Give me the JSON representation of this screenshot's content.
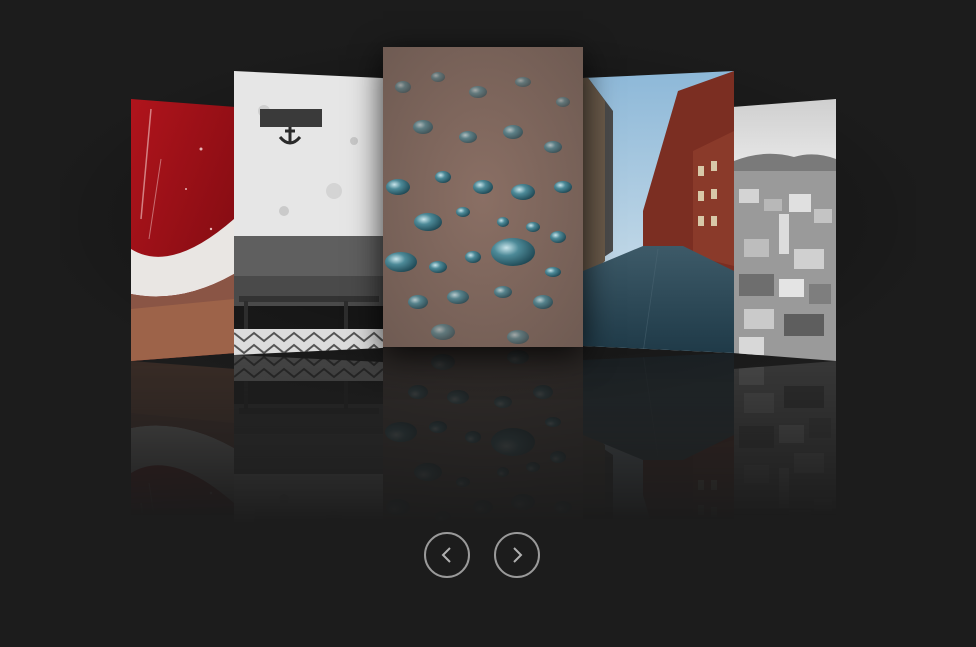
{
  "carousel": {
    "slides": [
      {
        "icon": "red-door-photo",
        "position": "far-left"
      },
      {
        "icon": "white-wall-anchor-bench-photo",
        "position": "left"
      },
      {
        "icon": "water-droplets-photo",
        "position": "center",
        "active": true
      },
      {
        "icon": "city-street-photo",
        "position": "right"
      },
      {
        "icon": "city-aerial-bw-photo",
        "position": "far-right"
      }
    ],
    "reflection": true
  },
  "navigation": {
    "prev_icon": "chevron-left-icon",
    "next_icon": "chevron-right-icon"
  },
  "colors": {
    "background": "#1c1c1c",
    "button_border": "#9a9a9a"
  }
}
